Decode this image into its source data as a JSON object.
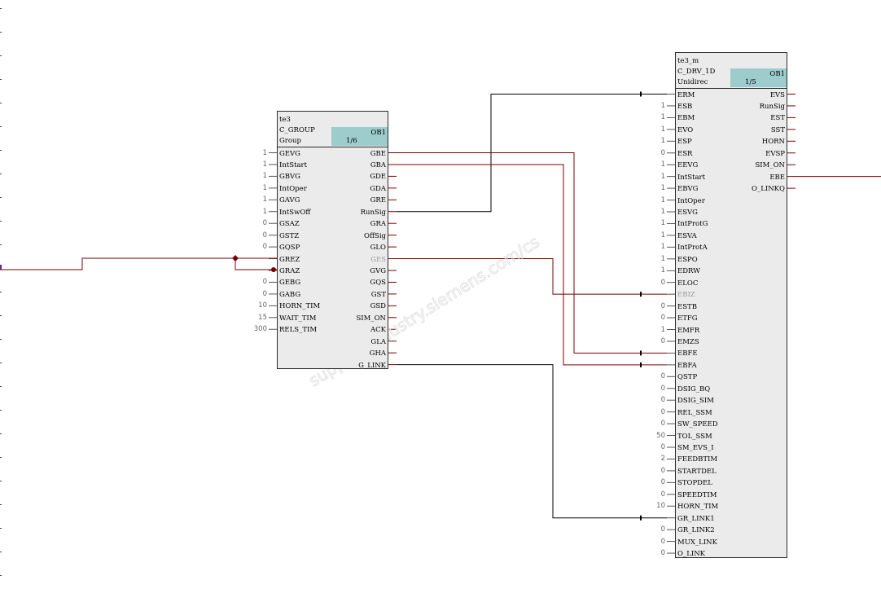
{
  "blocks": {
    "te3": {
      "name": "te3",
      "type": "C_GROUP",
      "comment": "Group",
      "ob": "OB1",
      "page": "1/6",
      "inputs": [
        {
          "label": "GEVG",
          "value": "1",
          "grey": false
        },
        {
          "label": "IntStart",
          "value": "1",
          "grey": false
        },
        {
          "label": "GBVG",
          "value": "1",
          "grey": false
        },
        {
          "label": "IntOper",
          "value": "1",
          "grey": false
        },
        {
          "label": "GAVG",
          "value": "1",
          "grey": false
        },
        {
          "label": "IntSwOff",
          "value": "1",
          "grey": false
        },
        {
          "label": "GSAZ",
          "value": "0",
          "grey": false
        },
        {
          "label": "GSTZ",
          "value": "0",
          "grey": false
        },
        {
          "label": "GQSP",
          "value": "0",
          "grey": false
        },
        {
          "label": "GREZ",
          "value": "",
          "grey": false
        },
        {
          "label": "GRAZ",
          "value": "",
          "grey": false
        },
        {
          "label": "GEBG",
          "value": "0",
          "grey": false
        },
        {
          "label": "GABG",
          "value": "0",
          "grey": false
        },
        {
          "label": "HORN_TIM",
          "value": "10",
          "grey": false
        },
        {
          "label": "WAIT_TIM",
          "value": "15",
          "grey": false
        },
        {
          "label": "RELS_TIM",
          "value": "300",
          "grey": false
        }
      ],
      "outputs": [
        {
          "label": "GBE",
          "grey": false
        },
        {
          "label": "GBA",
          "grey": false
        },
        {
          "label": "GDE",
          "grey": false
        },
        {
          "label": "GDA",
          "grey": false
        },
        {
          "label": "GRE",
          "grey": false
        },
        {
          "label": "RunSig",
          "grey": false
        },
        {
          "label": "GRA",
          "grey": false
        },
        {
          "label": "OffSig",
          "grey": false
        },
        {
          "label": "GLO",
          "grey": false
        },
        {
          "label": "GES",
          "grey": true
        },
        {
          "label": "GVG",
          "grey": false
        },
        {
          "label": "GQS",
          "grey": false
        },
        {
          "label": "GST",
          "grey": false
        },
        {
          "label": "GSD",
          "grey": false
        },
        {
          "label": "SIM_ON",
          "grey": false
        },
        {
          "label": "ACK",
          "grey": false
        },
        {
          "label": "GLA",
          "grey": false
        },
        {
          "label": "GHA",
          "grey": false
        },
        {
          "label": "G_LINK",
          "grey": false
        }
      ]
    },
    "te3m": {
      "name": "te3_m",
      "type": "C_DRV_1D",
      "comment": "Unidirec",
      "ob": "OB1",
      "page": "1/5",
      "inputs": [
        {
          "label": "ERM",
          "value": "",
          "grey": false
        },
        {
          "label": "ESB",
          "value": "1",
          "grey": false
        },
        {
          "label": "EBM",
          "value": "1",
          "grey": false
        },
        {
          "label": "EVO",
          "value": "1",
          "grey": false
        },
        {
          "label": "ESP",
          "value": "1",
          "grey": false
        },
        {
          "label": "ESR",
          "value": "0",
          "grey": false
        },
        {
          "label": "EEVG",
          "value": "1",
          "grey": false
        },
        {
          "label": "IntStart",
          "value": "1",
          "grey": false
        },
        {
          "label": "EBVG",
          "value": "1",
          "grey": false
        },
        {
          "label": "IntOper",
          "value": "1",
          "grey": false
        },
        {
          "label": "ESVG",
          "value": "1",
          "grey": false
        },
        {
          "label": "IntProtG",
          "value": "1",
          "grey": false
        },
        {
          "label": "ESVA",
          "value": "1",
          "grey": false
        },
        {
          "label": "IntProtA",
          "value": "1",
          "grey": false
        },
        {
          "label": "ESPO",
          "value": "1",
          "grey": false
        },
        {
          "label": "EDRW",
          "value": "1",
          "grey": false
        },
        {
          "label": "ELOC",
          "value": "0",
          "grey": false
        },
        {
          "label": "EBIZ",
          "value": "",
          "grey": true
        },
        {
          "label": "ESTB",
          "value": "0",
          "grey": false
        },
        {
          "label": "ETFG",
          "value": "0",
          "grey": false
        },
        {
          "label": "EMFR",
          "value": "1",
          "grey": false
        },
        {
          "label": "EMZS",
          "value": "0",
          "grey": false
        },
        {
          "label": "EBFE",
          "value": "",
          "grey": false
        },
        {
          "label": "EBFA",
          "value": "",
          "grey": false
        },
        {
          "label": "QSTP",
          "value": "0",
          "grey": false
        },
        {
          "label": "DSIG_BQ",
          "value": "0",
          "grey": false
        },
        {
          "label": "DSIG_SIM",
          "value": "0",
          "grey": false
        },
        {
          "label": "REL_SSM",
          "value": "0",
          "grey": false
        },
        {
          "label": "SW_SPEED",
          "value": "0",
          "grey": false
        },
        {
          "label": "TOL_SSM",
          "value": "50",
          "grey": false
        },
        {
          "label": "SM_EVS_I",
          "value": "0",
          "grey": false
        },
        {
          "label": "FEEDBTIM",
          "value": "2",
          "grey": false
        },
        {
          "label": "STARTDEL",
          "value": "0",
          "grey": false
        },
        {
          "label": "STOPDEL",
          "value": "0",
          "grey": false
        },
        {
          "label": "SPEEDTIM",
          "value": "0",
          "grey": false
        },
        {
          "label": "HORN_TIM",
          "value": "10",
          "grey": false
        },
        {
          "label": "GR_LINK1",
          "value": "",
          "grey": false
        },
        {
          "label": "GR_LINK2",
          "value": "0",
          "grey": false
        },
        {
          "label": "MUX_LINK",
          "value": "0",
          "grey": false
        },
        {
          "label": "O_LINK",
          "value": "0",
          "grey": false
        }
      ],
      "outputs": [
        {
          "label": "EVS",
          "grey": false
        },
        {
          "label": "RunSig",
          "grey": false
        },
        {
          "label": "EST",
          "grey": false
        },
        {
          "label": "SST",
          "grey": false
        },
        {
          "label": "HORN",
          "grey": false
        },
        {
          "label": "EVSP",
          "grey": false
        },
        {
          "label": "SIM_ON",
          "grey": false
        },
        {
          "label": "EBE",
          "grey": false
        },
        {
          "label": "O_LINKQ",
          "grey": false
        }
      ]
    }
  },
  "colors": {
    "wire_bool": "#7a0000",
    "wire_link": "#000000",
    "block_fill": "#ebebeb",
    "header_accent": "#9ccccc",
    "inactive_pin": "#9a9a9a",
    "watermark": "#e3e3e3"
  }
}
